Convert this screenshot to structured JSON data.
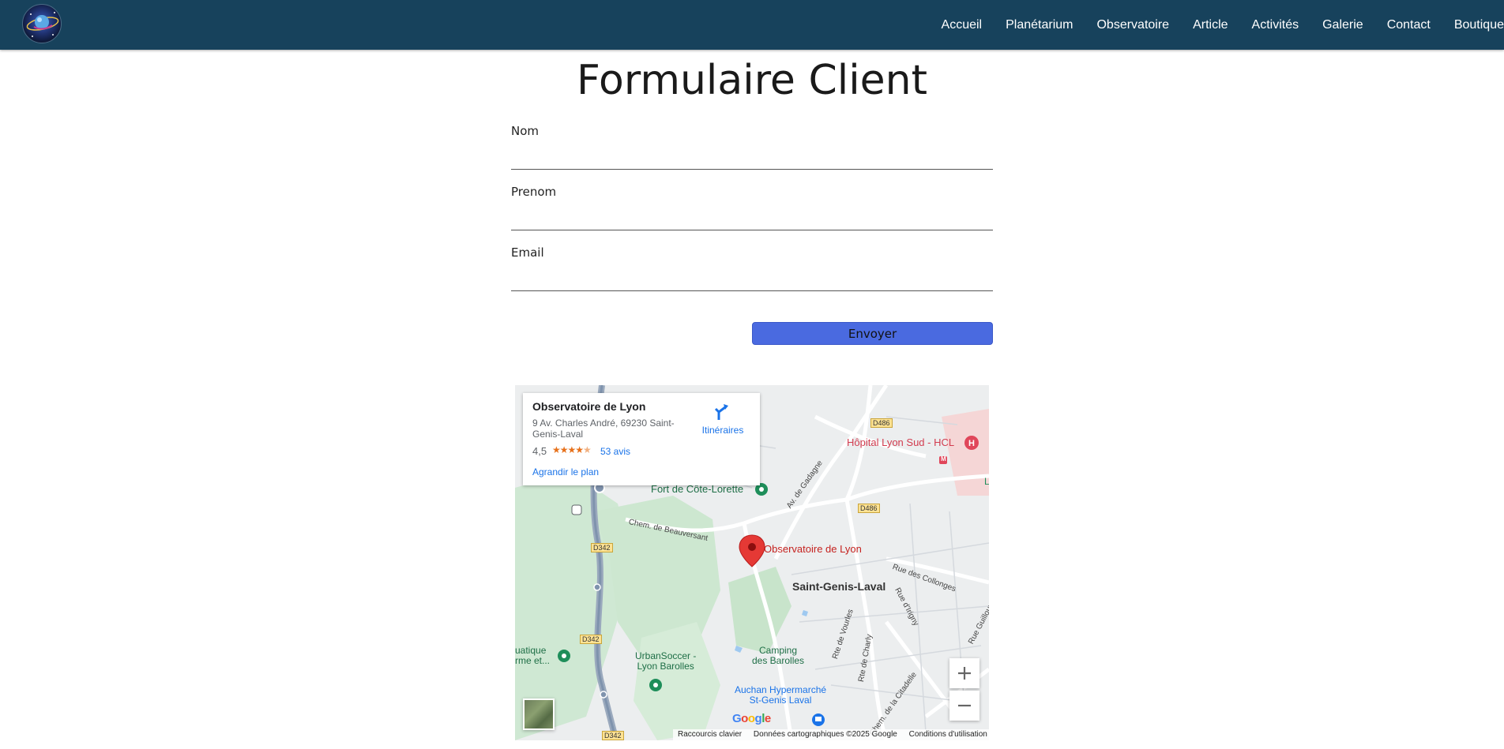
{
  "header": {
    "logo_icon": "observatory-planet-logo",
    "nav": [
      "Accueil",
      "Planétarium",
      "Observatoire",
      "Article",
      "Activités",
      "Galerie",
      "Contact",
      "Boutique"
    ],
    "background": "#17425c"
  },
  "page": {
    "title": "Formulaire Client"
  },
  "form": {
    "fields": [
      {
        "label": "Nom",
        "value": ""
      },
      {
        "label": "Prenom",
        "value": ""
      },
      {
        "label": "Email",
        "value": ""
      }
    ],
    "submit_label": "Envoyer",
    "submit_color": "#4a6ae0"
  },
  "map": {
    "card": {
      "name": "Observatoire de Lyon",
      "address": "9 Av. Charles André, 69230 Saint-Genis-Laval",
      "rating": "4,5",
      "rating_value": 4.5,
      "reviews": "53 avis",
      "directions": "Itinéraires",
      "enlarge": "Agrandir le plan"
    },
    "labels": {
      "hospital": "Hôpital Lyon Sud - HCL",
      "fort": "Fort de Côte-Lorette",
      "road_beauversant": "Chem. de Beauversant",
      "av_gadagne": "Av. de Gadagne",
      "marker": "Observatoire de Lyon",
      "town": "Saint-Genis-Laval",
      "rue_collonges": "Rue des Collonges",
      "rue_grigny": "Rue d'Irigny",
      "rue_guilloux": "Rue Guilloux",
      "rte_vourles": "Rte de Vourles",
      "rte_charly": "Rte de Charly",
      "chem_citadelle": "Chem. de la Citadelle",
      "camping": "Camping\ndes Barolles",
      "urbansoccer": "UrbanSoccer -\nLyon Barolles",
      "aquatique": "uatique\nrme et...",
      "auchan": "Auchan Hypermarché\nSt-Genis Laval",
      "d486a": "D486",
      "d486b": "D486",
      "d342a": "D342",
      "d342b": "D342",
      "d342c": "D342",
      "l_edge": "L",
      "m_badge": "M"
    },
    "google": "Google",
    "attribution": [
      "Raccourcis clavier",
      "Données cartographiques ©2025 Google",
      "Conditions d'utilisation"
    ],
    "zoom_in_icon": "plus-icon",
    "zoom_out_icon": "minus-icon"
  }
}
